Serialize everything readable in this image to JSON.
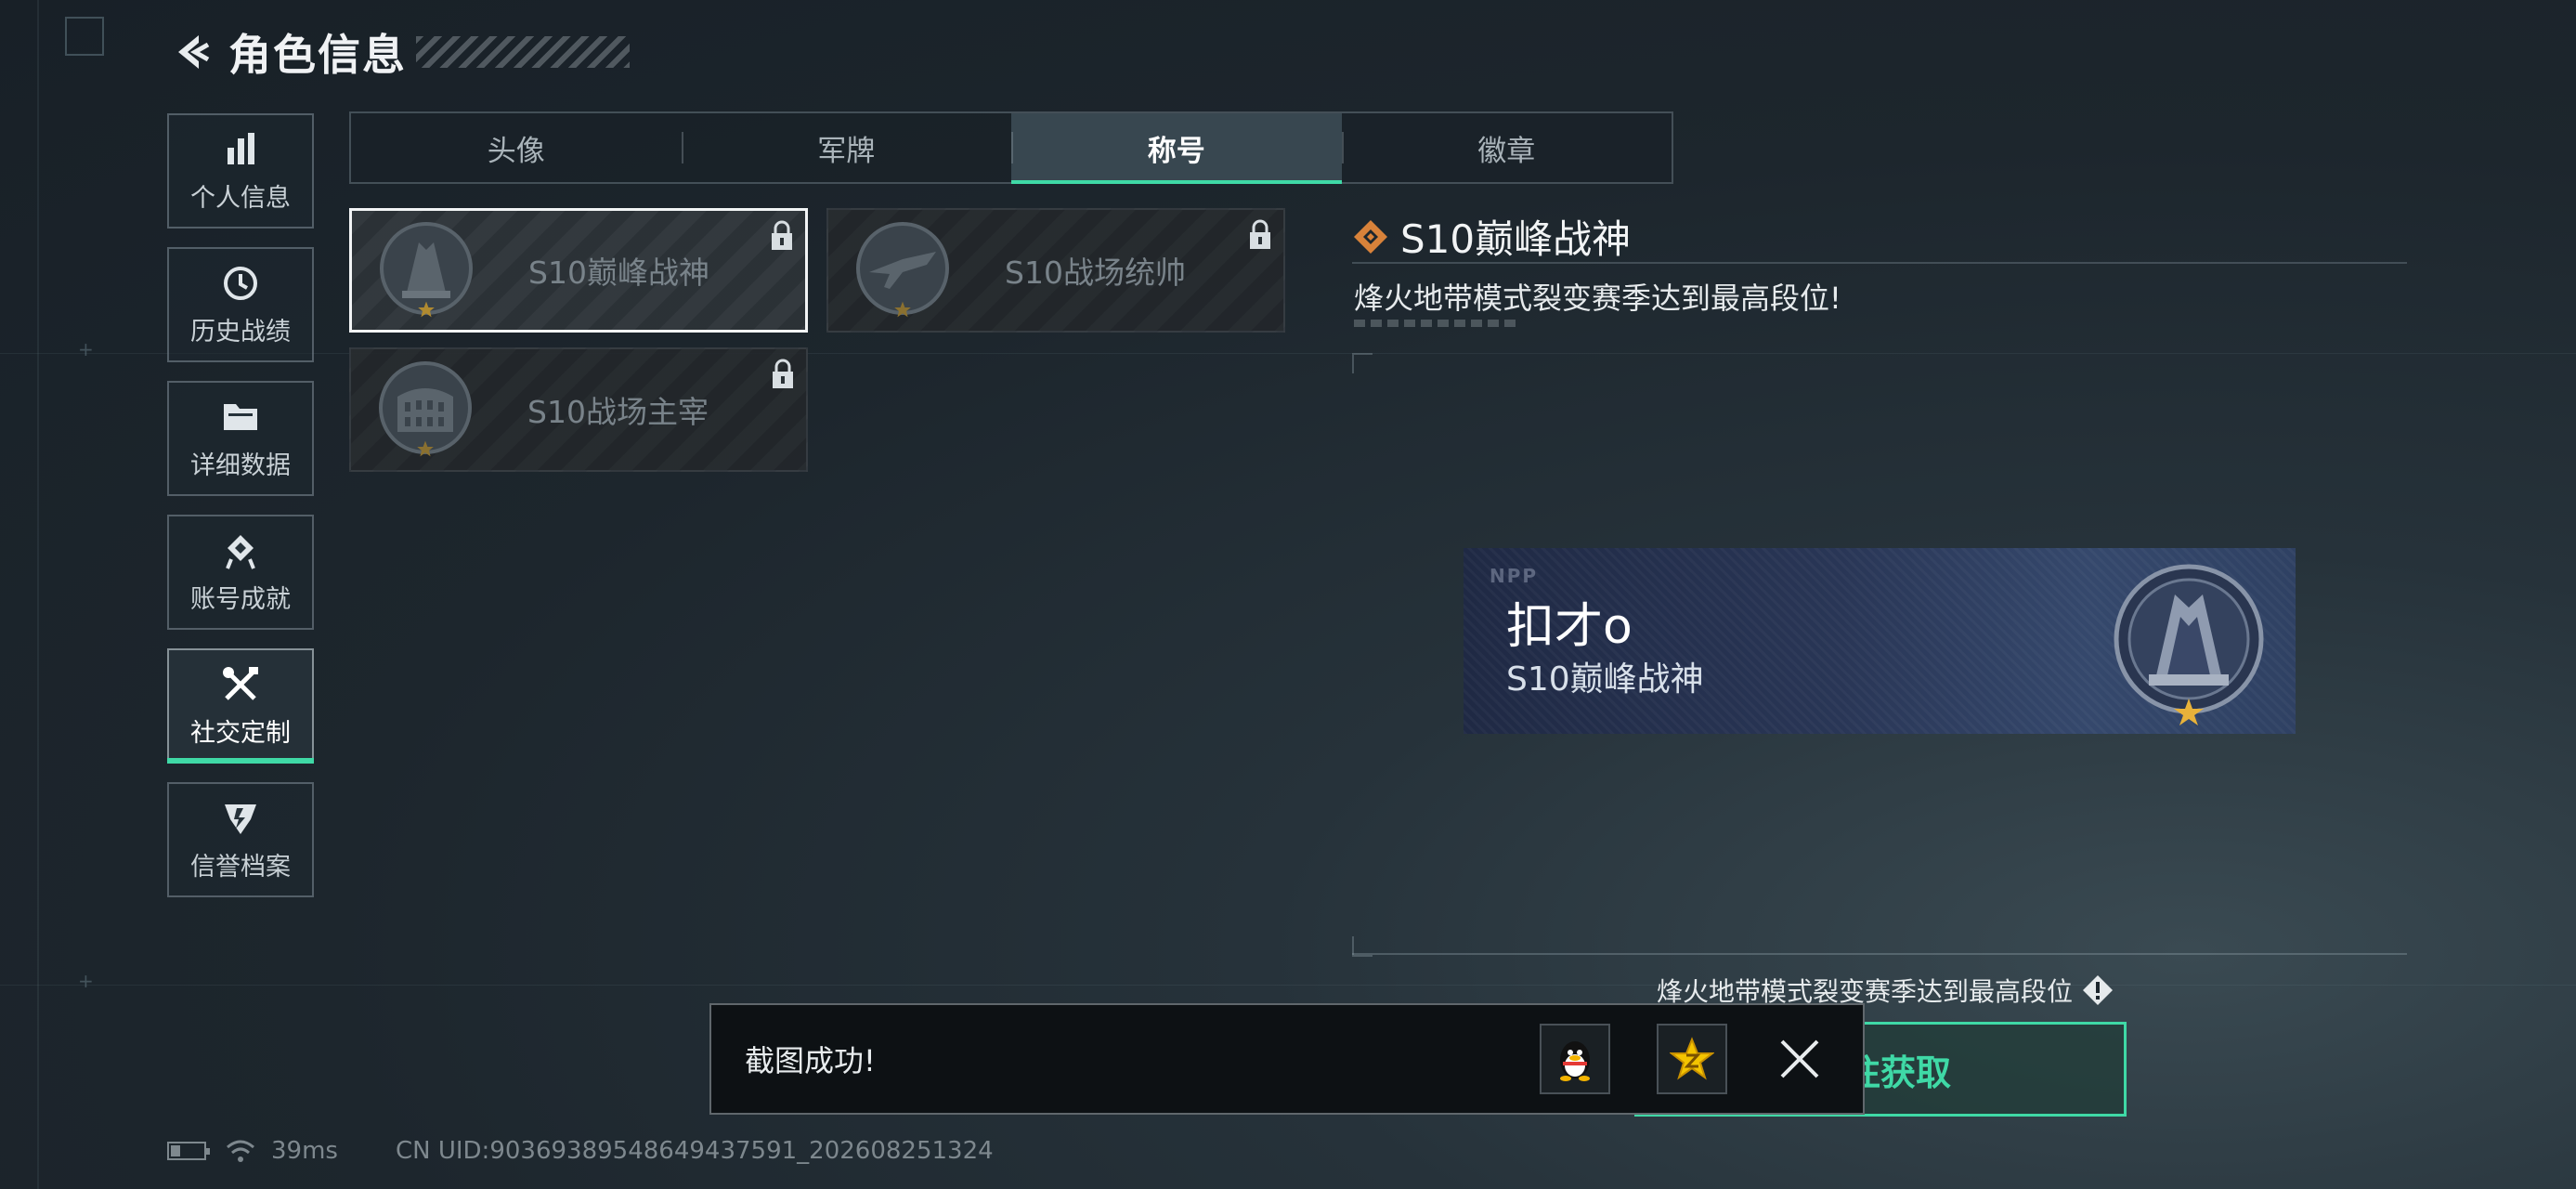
{
  "header": {
    "title": "角色信息"
  },
  "sidebar": {
    "items": [
      {
        "label": "个人信息",
        "icon": "bar-chart-icon"
      },
      {
        "label": "历史战绩",
        "icon": "history-clock-icon"
      },
      {
        "label": "详细数据",
        "icon": "folder-icon"
      },
      {
        "label": "账号成就",
        "icon": "achievement-badge-icon"
      },
      {
        "label": "社交定制",
        "icon": "tools-icon",
        "active": true
      },
      {
        "label": "信誉档案",
        "icon": "credit-shield-icon"
      }
    ]
  },
  "tabs": [
    {
      "label": "头像"
    },
    {
      "label": "军牌"
    },
    {
      "label": "称号",
      "active": true
    },
    {
      "label": "徽章"
    }
  ],
  "titles": [
    {
      "name": "S10巅峰战神",
      "locked": true,
      "selected": true,
      "icon": "peak-god-emblem-icon"
    },
    {
      "name": "S10战场统帅",
      "locked": true,
      "selected": false,
      "icon": "commander-plane-emblem-icon"
    },
    {
      "name": "S10战场主宰",
      "locked": true,
      "selected": false,
      "icon": "dominator-colosseum-emblem-icon"
    }
  ],
  "detail": {
    "title": "S10巅峰战神",
    "description": "烽火地带模式裂变赛季达到最高段位!",
    "plate": {
      "player_name": "扣才o",
      "title": "S10巅峰战神",
      "logo": "NPP"
    },
    "condition": "烽火地带模式裂变赛季达到最高段位",
    "goto_button": "前往获取"
  },
  "toast": {
    "message": "截图成功!"
  },
  "status": {
    "ping": "39ms",
    "uid": "CN UID:9036938954864943759​1_202608251324"
  },
  "colors": {
    "accent": "#3fd9a6",
    "gold": "#e8b23a",
    "diamond": "#d8823a"
  }
}
